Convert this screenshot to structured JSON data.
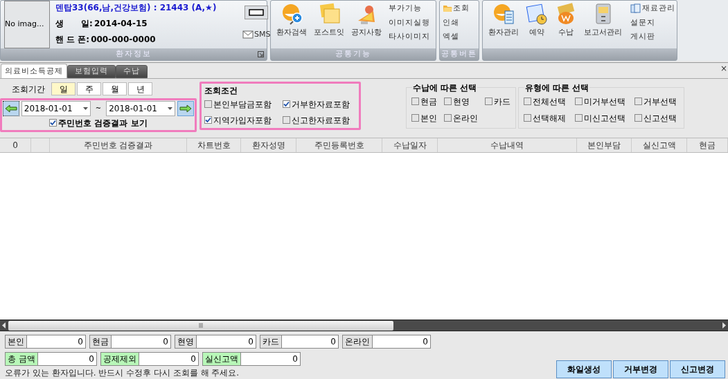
{
  "patient_info": {
    "photo_placeholder": "No imag...",
    "name_line": "덴탑33(66,남,건강보험) : 21443 (A,★)",
    "birth_label": "생      일:",
    "birth_value": "2014-04-15",
    "phone_label": "핸 드 폰:",
    "phone_value": "000-000-0000",
    "sms_button": "SMS",
    "group_label": "환자정보"
  },
  "common_functions": {
    "group_label": "공통기능",
    "big_buttons": [
      "환자검색",
      "포스트잇",
      "공지사항"
    ],
    "small_buttons": [
      "부가기능",
      "이미지실행",
      "타사이미지"
    ]
  },
  "common_buttons": {
    "group_label": "공통버튼",
    "items": [
      "조회",
      "인쇄",
      "엑셀"
    ]
  },
  "management": {
    "big_buttons": [
      "환자관리",
      "예약",
      "수납",
      "보고서관리"
    ],
    "small_buttons": [
      "재료관리",
      "설문지",
      "게시판"
    ]
  },
  "tabs": [
    {
      "label": "의료비소득공제",
      "selected": true
    },
    {
      "label": "보험입력",
      "selected": false
    },
    {
      "label": "수납",
      "selected": false
    }
  ],
  "close_mark": "×",
  "period": {
    "label": "조회기간",
    "units": [
      {
        "label": "일",
        "selected": true
      },
      {
        "label": "주",
        "selected": false
      },
      {
        "label": "월",
        "selected": false
      },
      {
        "label": "년",
        "selected": false
      }
    ],
    "from": "2018-01-01",
    "separator": "~",
    "to": "2018-01-01",
    "verification": {
      "label": "주민번호 검증결과 보기",
      "checked": true
    }
  },
  "conditions": {
    "title": "조회조건",
    "options": [
      {
        "label": "본인부담금포함",
        "checked": false
      },
      {
        "label": "거부한자료포함",
        "checked": true
      },
      {
        "label": "지역가입자포함",
        "checked": true
      },
      {
        "label": "신고한자료포함",
        "checked": false
      }
    ]
  },
  "payment_select": {
    "title": "수납에 따른 선택",
    "options": [
      {
        "label": "현금",
        "checked": false
      },
      {
        "label": "현영",
        "checked": false
      },
      {
        "label": "카드",
        "checked": false
      },
      {
        "label": "본인",
        "checked": false
      },
      {
        "label": "온라인",
        "checked": false
      }
    ]
  },
  "type_select": {
    "title": "유형에 따른 선택",
    "options": [
      {
        "label": "전체선택",
        "checked": false
      },
      {
        "label": "미거부선택",
        "checked": false
      },
      {
        "label": "거부선택",
        "checked": false
      },
      {
        "label": "선택해제",
        "checked": false
      },
      {
        "label": "미신고선택",
        "checked": false
      },
      {
        "label": "신고선택",
        "checked": false
      }
    ]
  },
  "table": {
    "columns": [
      "0",
      "",
      "주민번호 검증결과",
      "차트번호",
      "환자성명",
      "주민등록번호",
      "수납일자",
      "수납내역",
      "본인부담",
      "실신고액",
      "현금"
    ]
  },
  "totals": [
    [
      {
        "label": "본인",
        "value": "0",
        "kind": "plain"
      },
      {
        "label": "현금",
        "value": "0",
        "kind": "plain"
      },
      {
        "label": "현영",
        "value": "0",
        "kind": "plain"
      },
      {
        "label": "카드",
        "value": "0",
        "kind": "plain"
      },
      {
        "label": "온라인",
        "value": "0",
        "kind": "plain"
      }
    ],
    [
      {
        "label": "총 금액",
        "value": "0",
        "kind": "sum"
      },
      {
        "label": "공제제외",
        "value": "0",
        "kind": "sum"
      },
      {
        "label": "실신고액",
        "value": "0",
        "kind": "sum"
      }
    ]
  ],
  "message": "오류가 있는 환자입니다. 반드시 수정후 다시 조회를 해 주세요.",
  "action_buttons": [
    "화일생성",
    "거부변경",
    "신고변경"
  ]
}
